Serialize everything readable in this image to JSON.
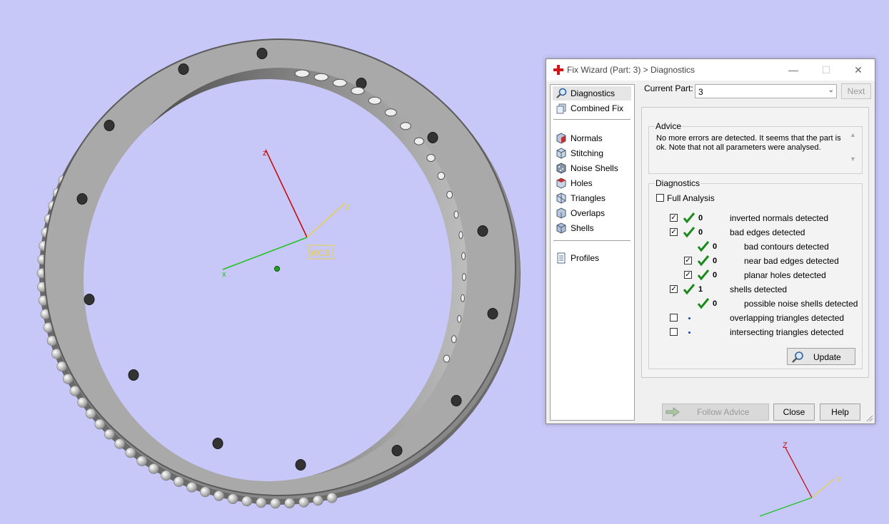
{
  "viewport": {
    "wcs_label": "WCS",
    "axis_x": "x",
    "axis_y": "y",
    "axis_z": "z",
    "corner_axis_y": "Y",
    "corner_axis_z": "Z"
  },
  "dialog": {
    "title": "Fix Wizard (Part: 3) > Diagnostics",
    "nav": {
      "items_top": [
        {
          "label": "Diagnostics",
          "icon": "magnifier-icon"
        },
        {
          "label": "Combined Fix",
          "icon": "combined-fix-icon"
        }
      ],
      "items_mid": [
        {
          "label": "Normals",
          "icon": "normals-cube-icon"
        },
        {
          "label": "Stitching",
          "icon": "stitching-cube-icon"
        },
        {
          "label": "Noise Shells",
          "icon": "noise-shells-cube-icon"
        },
        {
          "label": "Holes",
          "icon": "holes-cube-icon"
        },
        {
          "label": "Triangles",
          "icon": "triangles-cube-icon"
        },
        {
          "label": "Overlaps",
          "icon": "overlaps-cube-icon"
        },
        {
          "label": "Shells",
          "icon": "shells-cube-icon"
        }
      ],
      "items_bottom": [
        {
          "label": "Profiles",
          "icon": "document-icon"
        }
      ]
    },
    "current_part_label": "Current Part:",
    "current_part_value": "3",
    "next_label": "Next",
    "advice": {
      "title": "Advice",
      "text": "No more errors are detected. It seems that the part is ok. Note that not all parameters were analysed."
    },
    "diagnostics": {
      "title": "Diagnostics",
      "full_analysis_label": "Full Analysis",
      "full_analysis_checked": false,
      "rows": [
        {
          "count": "0",
          "label": "inverted normals detected",
          "checkbox": true,
          "checked": true,
          "status": "ok"
        },
        {
          "count": "0",
          "label": "bad edges detected",
          "checkbox": true,
          "checked": true,
          "status": "ok"
        },
        {
          "count": "0",
          "label": "bad contours detected",
          "checkbox": false,
          "checked": false,
          "status": "ok"
        },
        {
          "count": "0",
          "label": "near bad edges detected",
          "checkbox": true,
          "checked": true,
          "status": "ok"
        },
        {
          "count": "0",
          "label": "planar holes detected",
          "checkbox": true,
          "checked": true,
          "status": "ok"
        },
        {
          "count": "1",
          "label": "shells detected",
          "checkbox": true,
          "checked": true,
          "status": "ok"
        },
        {
          "count": "0",
          "label": "possible noise shells detected",
          "checkbox": false,
          "checked": false,
          "status": "ok"
        },
        {
          "count": "",
          "label": "overlapping triangles detected",
          "checkbox": true,
          "checked": false,
          "status": "not-analysed"
        },
        {
          "count": "",
          "label": "intersecting triangles detected",
          "checkbox": true,
          "checked": false,
          "status": "not-analysed"
        }
      ]
    },
    "update_label": "Update",
    "follow_advice_label": "Follow Advice",
    "close_label": "Close",
    "help_label": "Help"
  }
}
